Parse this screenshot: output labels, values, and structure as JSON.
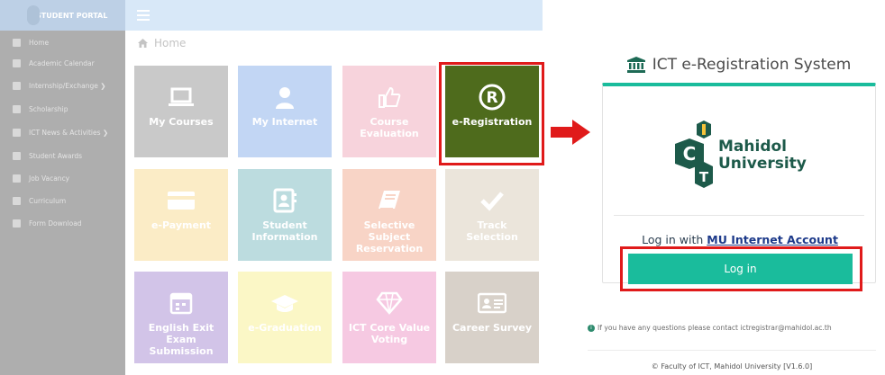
{
  "portal": {
    "brand": "STUDENT PORTAL",
    "breadcrumb": "Home",
    "sidebar": [
      {
        "label": "Home"
      },
      {
        "label": "Academic Calendar"
      },
      {
        "label": "Internship/Exchange ❯"
      },
      {
        "label": "Scholarship"
      },
      {
        "label": "ICT News & Activities ❯"
      },
      {
        "label": "Student Awards"
      },
      {
        "label": "Job Vacancy"
      },
      {
        "label": "Curriculum"
      },
      {
        "label": "Form Download"
      }
    ],
    "tiles": [
      {
        "label": "My Courses",
        "color": "#c9c9c9",
        "icon": "laptop-icon"
      },
      {
        "label": "My Internet",
        "color": "#c2d6f4",
        "icon": "user-icon"
      },
      {
        "label": "Course Evaluation",
        "color": "#f7d3dc",
        "icon": "thumbs-up-icon"
      },
      {
        "label": "e-Registration",
        "color": "#4e6b1c",
        "icon": "registered-icon"
      },
      {
        "label": "e-Payment",
        "color": "#fbecc6",
        "icon": "credit-card-icon"
      },
      {
        "label": "Student Information",
        "color": "#bcdcdf",
        "icon": "address-book-icon"
      },
      {
        "label": "Selective Subject Reservation",
        "color": "#f8d4c6",
        "icon": "book-icon"
      },
      {
        "label": "Track Selection",
        "color": "#ebe5db",
        "icon": "check-icon"
      },
      {
        "label": "English Exit Exam Submission",
        "color": "#d2c4e8",
        "icon": "calendar-icon"
      },
      {
        "label": "e-Graduation",
        "color": "#fbf7c6",
        "icon": "graduation-cap-icon"
      },
      {
        "label": "ICT Core Value Voting",
        "color": "#f6c9e2",
        "icon": "diamond-icon"
      },
      {
        "label": "Career Survey",
        "color": "#d8d1c9",
        "icon": "id-card-icon"
      }
    ]
  },
  "login": {
    "title": "ICT e-Registration System",
    "university_line1": "Mahidol",
    "university_line2": "University",
    "login_with_prefix": "Log in with ",
    "login_with_link": "MU Internet Account",
    "button": "Log in",
    "info": "If you have any questions please contact ictregistrar@mahidol.ac.th",
    "footer": "© Faculty of ICT, Mahidol University [V1.6.0]"
  },
  "colors": {
    "accent": "#1abc9c",
    "highlight": "#e01a1a",
    "logo_green": "#1d5a4a"
  }
}
